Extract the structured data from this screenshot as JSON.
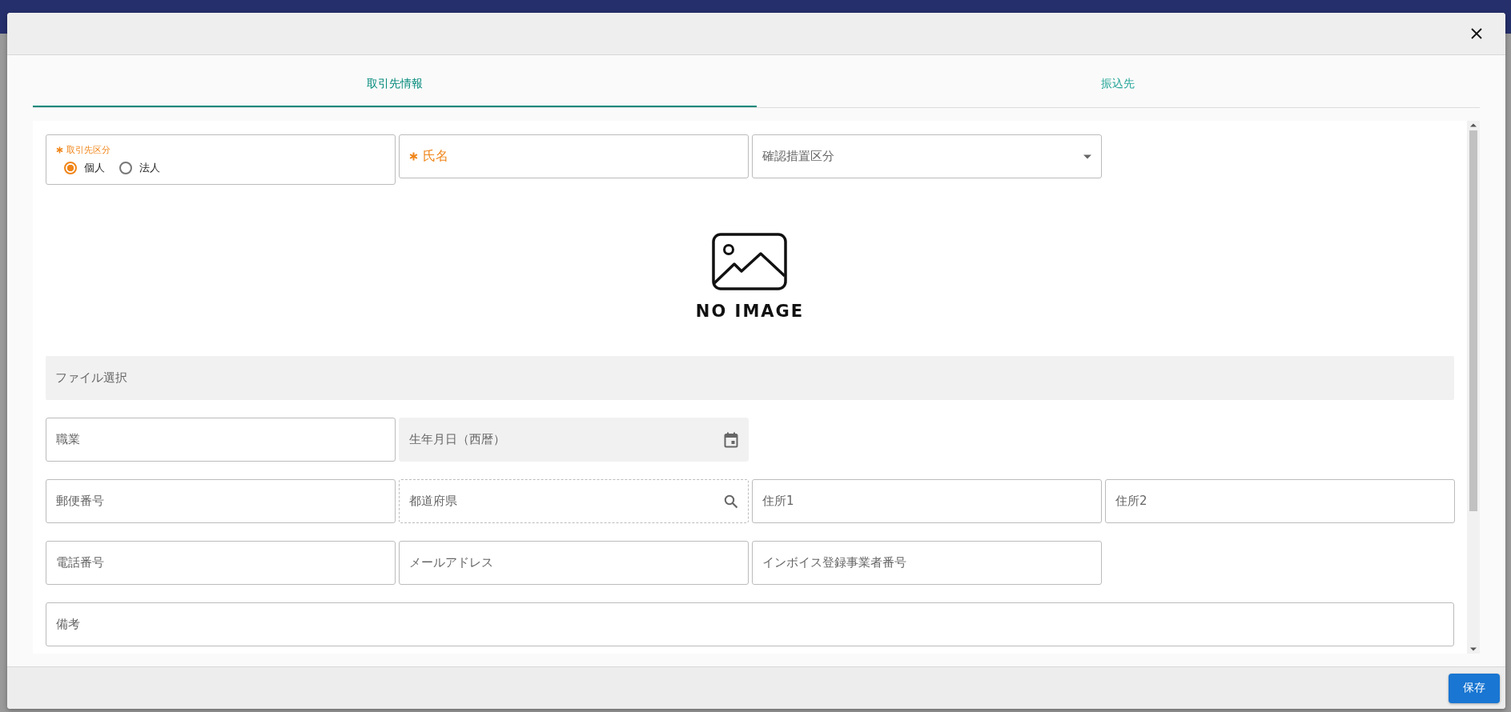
{
  "tabs": [
    {
      "label": "取引先情報",
      "selected": true
    },
    {
      "label": "振込先",
      "selected": false
    }
  ],
  "rows": [
    [
      {
        "kind": "radio",
        "label": "取引先区分",
        "required": true,
        "options": [
          {
            "label": "個人",
            "selected": true
          },
          {
            "label": "法人",
            "selected": false
          }
        ]
      },
      {
        "kind": "text",
        "label": "氏名",
        "required": true
      },
      {
        "kind": "select",
        "label": "確認措置区分",
        "required": false
      }
    ],
    [
      {
        "kind": "image",
        "caption": "NO IMAGE"
      }
    ],
    [
      {
        "kind": "file",
        "label": "ファイル選択"
      }
    ],
    [
      {
        "kind": "text",
        "label": "職業",
        "required": false
      },
      {
        "kind": "date",
        "label": "生年月日（西暦）",
        "required": false
      }
    ],
    [
      {
        "kind": "text",
        "label": "郵便番号",
        "required": false
      },
      {
        "kind": "search",
        "label": "都道府県",
        "required": false
      },
      {
        "kind": "text",
        "label": "住所1",
        "required": false
      },
      {
        "kind": "text",
        "label": "住所2",
        "required": false
      }
    ],
    [
      {
        "kind": "text",
        "label": "電話番号",
        "required": false
      },
      {
        "kind": "text",
        "label": "メールアドレス",
        "required": false
      },
      {
        "kind": "text",
        "label": "インボイス登録事業者番号",
        "required": false
      }
    ],
    [
      {
        "kind": "wide",
        "label": "備考",
        "required": false
      }
    ]
  ],
  "save_button": "保存"
}
